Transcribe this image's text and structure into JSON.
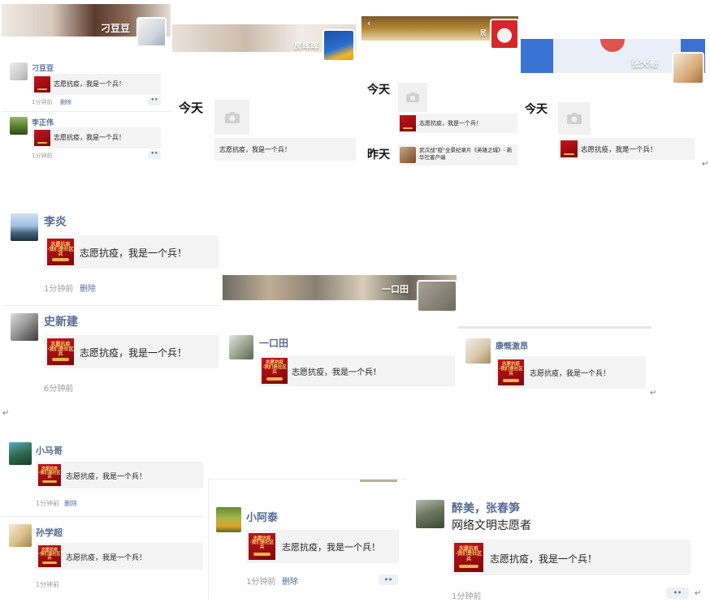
{
  "moment_text": "志愿抗疫，我是一个兵！",
  "thumb_title": "志愿抗疫\n·我们是社区兵",
  "delete_label": "删除",
  "dots_label": "••",
  "paragraph_mark": "↵",
  "days": {
    "today": "今天",
    "yesterday": "昨天"
  },
  "panels": {
    "p1": {
      "cover_title": "刁豆豆",
      "posts": [
        {
          "name": "刁豆豆",
          "time": "1分钟前",
          "show_delete": true
        },
        {
          "name": "李正伟",
          "time": "1分钟前",
          "show_delete": false
        }
      ]
    },
    "p2": {
      "cover_title": "房晖晖"
    },
    "p3": {
      "cover_title": "民",
      "yesterday_text": "武汉战\"疫\"全景纪录片《英雄之城》- 新华社客户端"
    },
    "p4": {
      "cover_title": "张大哥"
    },
    "p5": {
      "posts": [
        {
          "name": "李炎",
          "time": "1分钟前",
          "show_delete": true
        },
        {
          "name": "史新建",
          "time": "6分钟前",
          "show_delete": false
        }
      ]
    },
    "p6": {
      "cover_title": "一口田",
      "post_name": "一口田"
    },
    "p7": {
      "post_name": "康慨激昂"
    },
    "p8": {
      "posts": [
        {
          "name": "小马哥",
          "time": "1分钟前",
          "show_delete": true
        },
        {
          "name": "孙学超",
          "time": "1分钟前",
          "show_delete": false
        }
      ]
    },
    "p9": {
      "post_name": "小阿泰",
      "time": "1分钟前"
    },
    "p10": {
      "post_name": "醉美，张春笋",
      "subtitle": "网络文明志愿者",
      "time": "1分钟前"
    }
  },
  "colors": {
    "name_blue": "#576b95",
    "meta_gray": "#9a9a9a",
    "card_bg": "#f3f3f3",
    "thumb_red": "#c4141b"
  }
}
